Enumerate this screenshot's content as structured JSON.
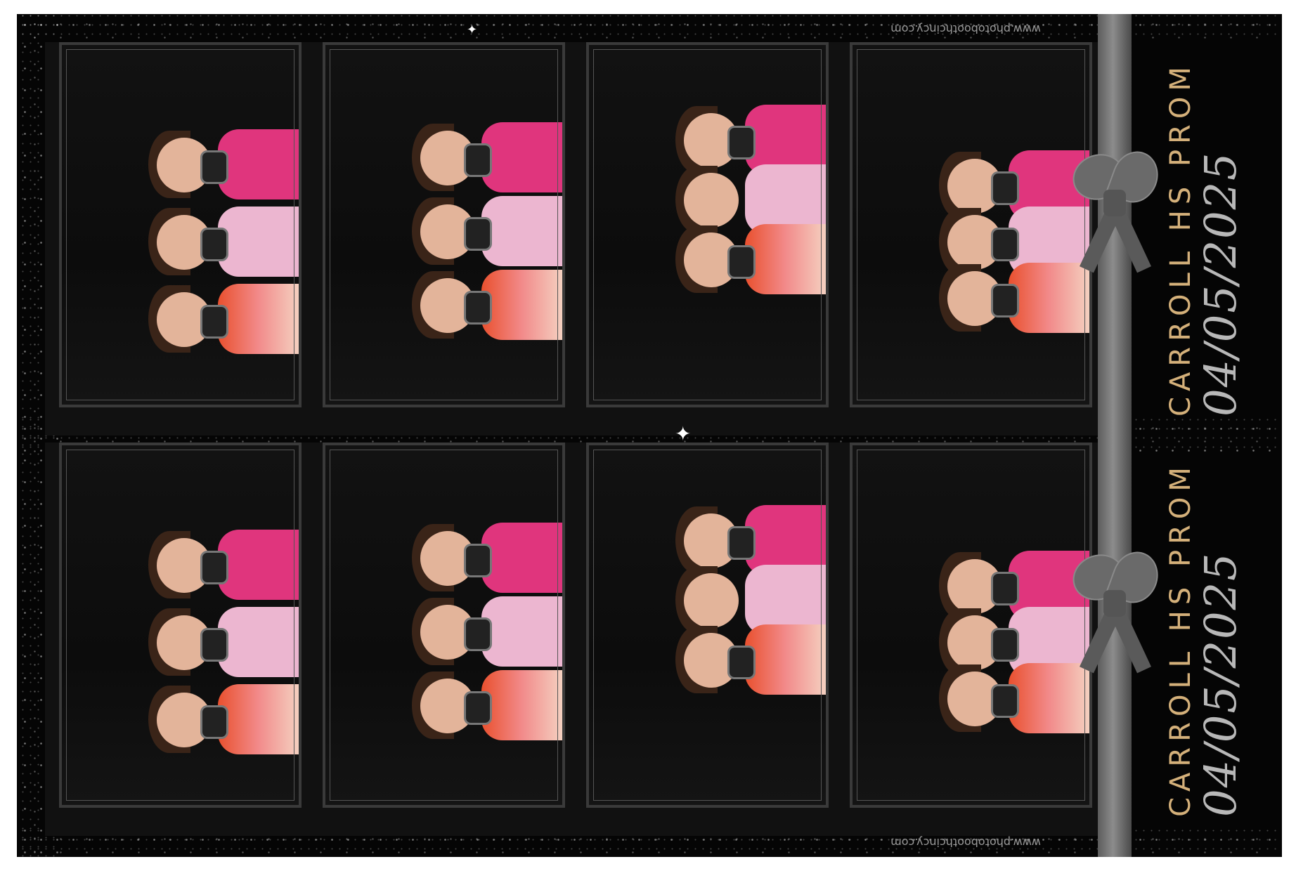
{
  "event": {
    "title": "CARROLL HS PROM",
    "date": "04/05/2025",
    "website": "www.photoboothcincy.com"
  },
  "colors": {
    "background": "#050505",
    "title_gold": "#d4b07a",
    "date_gray": "#b8b8b8",
    "ribbon": "#7a7a7a"
  },
  "icons": [
    "bow-icon",
    "sparkle-icon"
  ]
}
